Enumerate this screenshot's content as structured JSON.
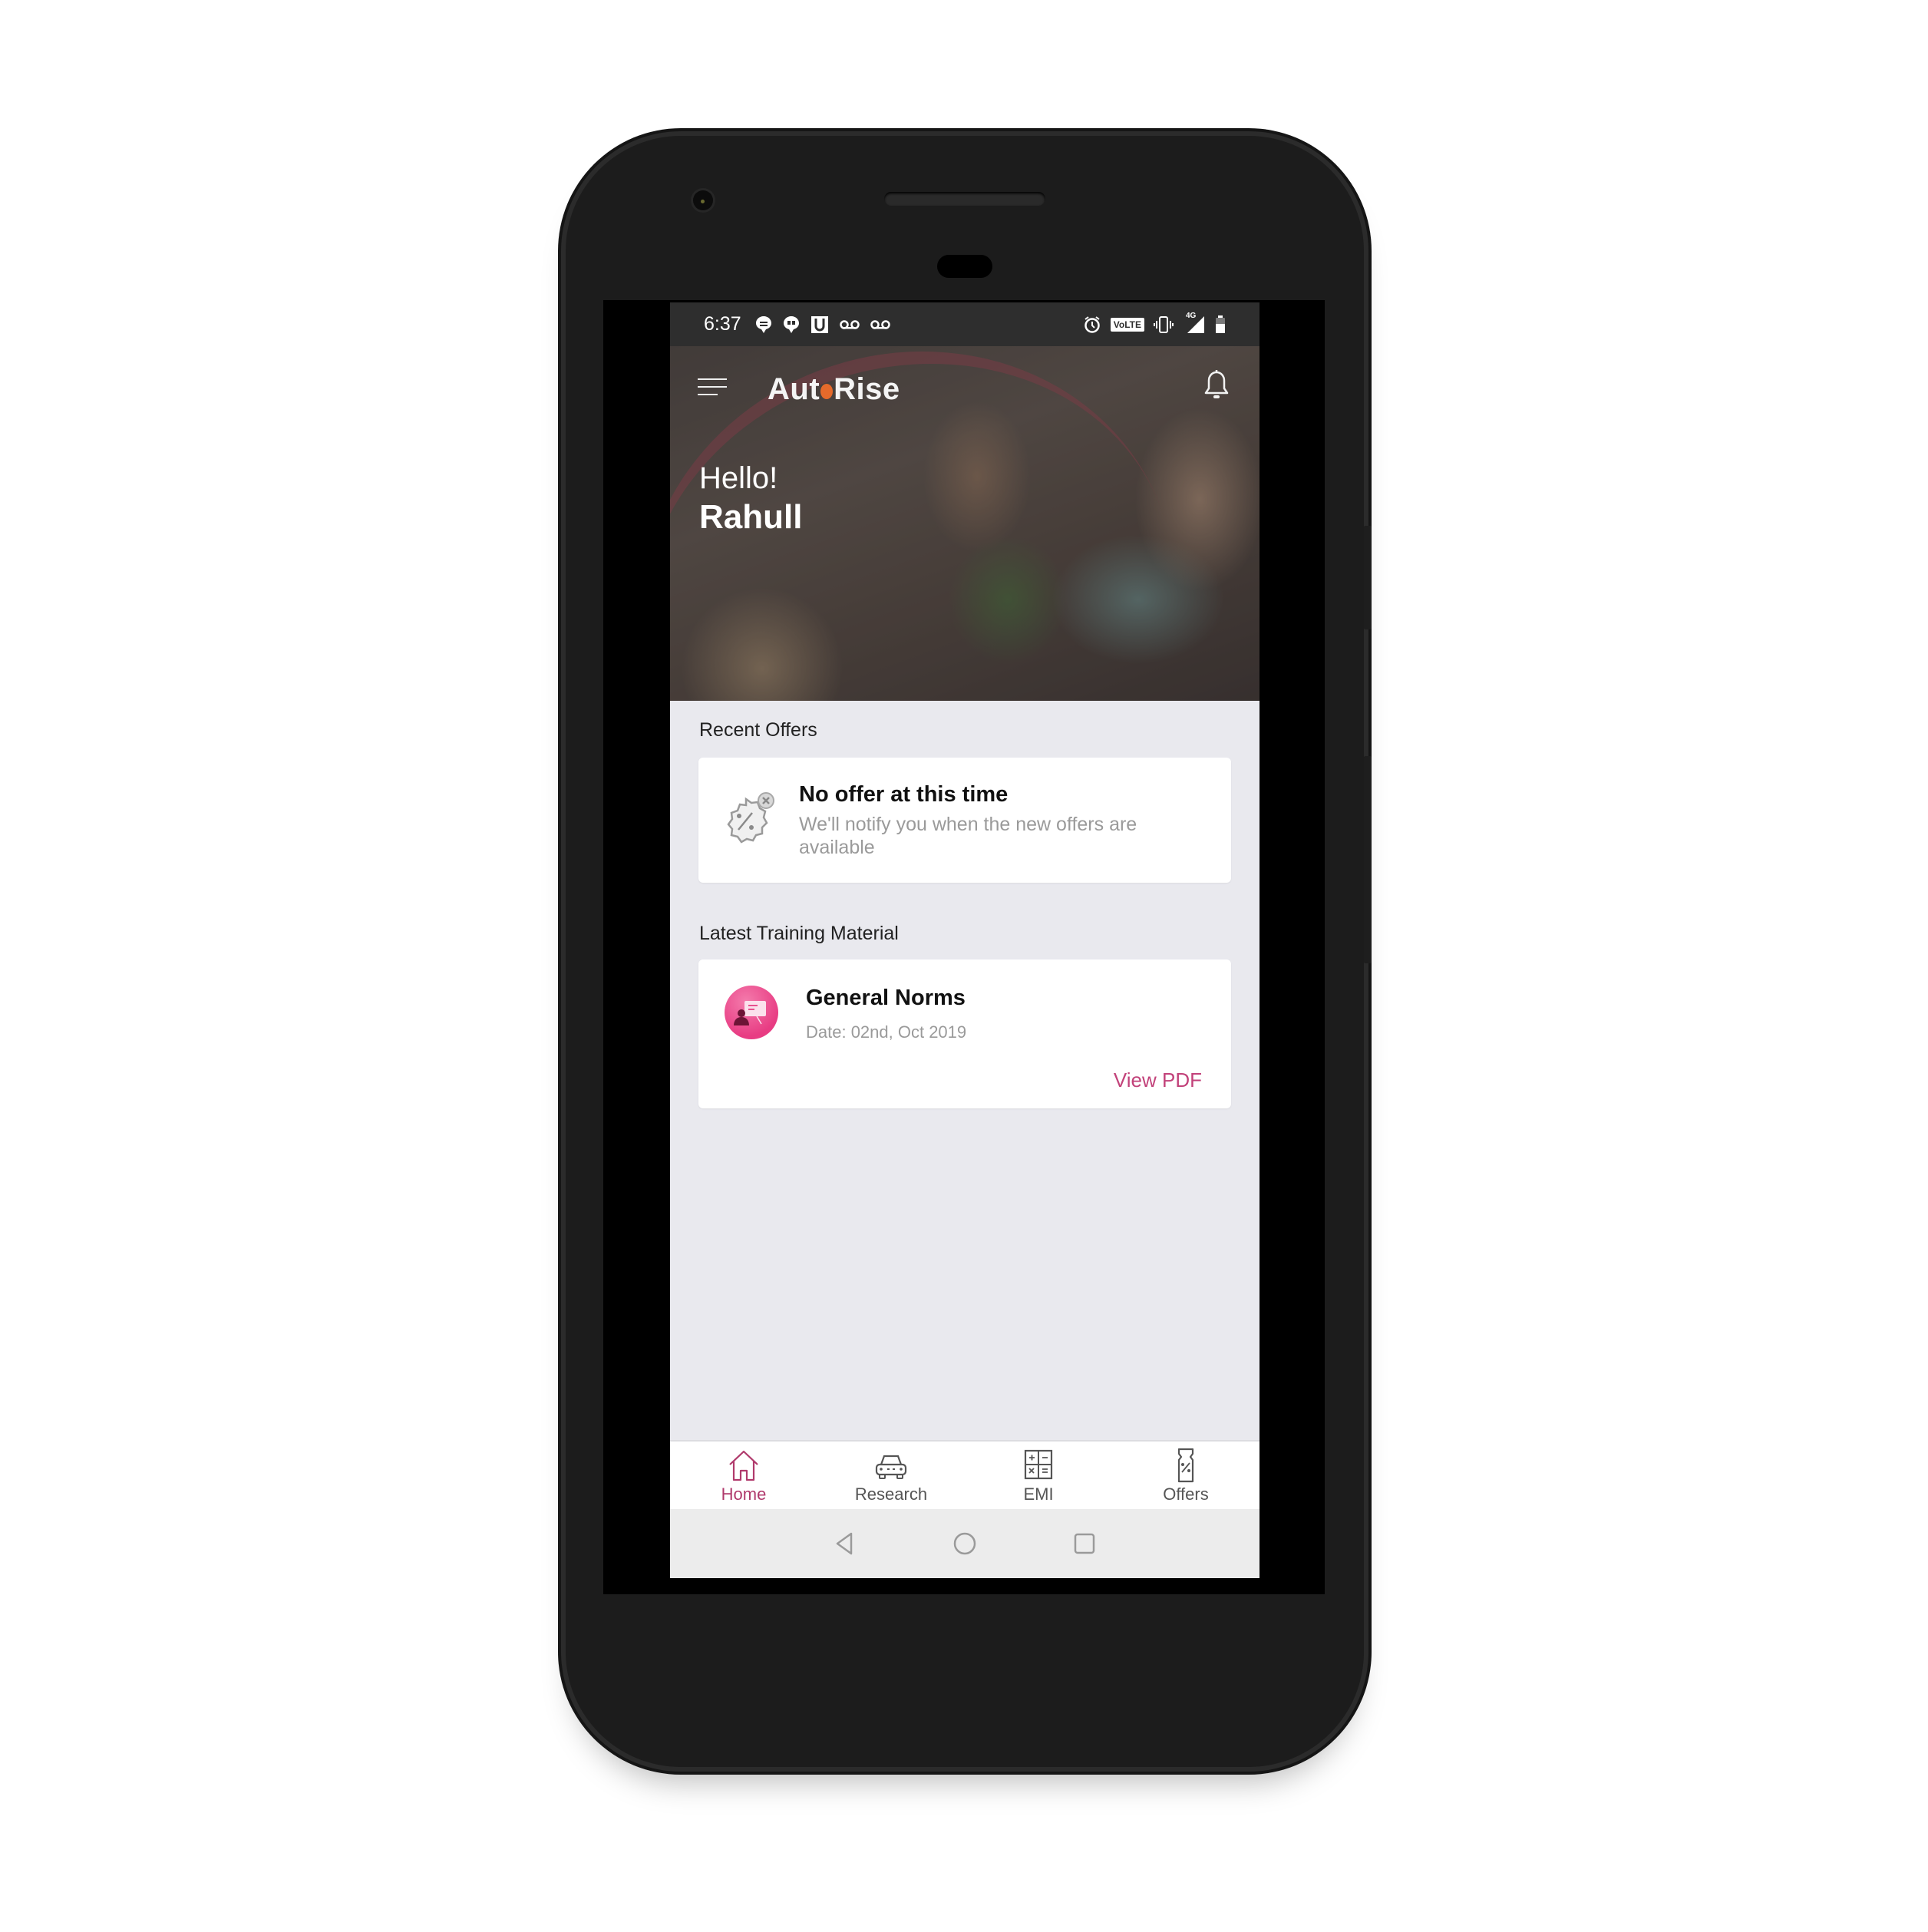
{
  "status_bar": {
    "time": "6:37",
    "left_icons": [
      "message-icon",
      "hangouts-icon",
      "u-app-icon",
      "voicemail-icon",
      "voicemail-icon"
    ],
    "right_icons": [
      "alarm-icon",
      "volte-badge",
      "vibrate-icon",
      "signal-4g-icon",
      "battery-icon"
    ],
    "volte_label": "VoLTE",
    "network_label": "4G"
  },
  "header": {
    "app_name_part1": "Aut",
    "app_name_part2": "Rise",
    "logo_accent_color": "#e56a2b",
    "greeting": "Hello!",
    "user_name": "Rahull"
  },
  "recent_offers": {
    "section_title": "Recent Offers",
    "empty_title": "No offer at this time",
    "empty_message": "We'll notify you when the new offers are available"
  },
  "training": {
    "section_title": "Latest Training Material",
    "items": [
      {
        "title": "General Norms",
        "date": "Date: 02nd, Oct 2019",
        "action_label": "View PDF"
      }
    ]
  },
  "bottom_nav": {
    "active_color": "#b03a6c",
    "items": [
      {
        "label": "Home",
        "icon": "home-icon",
        "active": true
      },
      {
        "label": "Research",
        "icon": "car-icon",
        "active": false
      },
      {
        "label": "EMI",
        "icon": "calculator-icon",
        "active": false
      },
      {
        "label": "Offers",
        "icon": "coupon-icon",
        "active": false
      }
    ]
  },
  "system_nav": {
    "buttons": [
      "back-icon",
      "home-circle-icon",
      "recents-icon"
    ]
  }
}
